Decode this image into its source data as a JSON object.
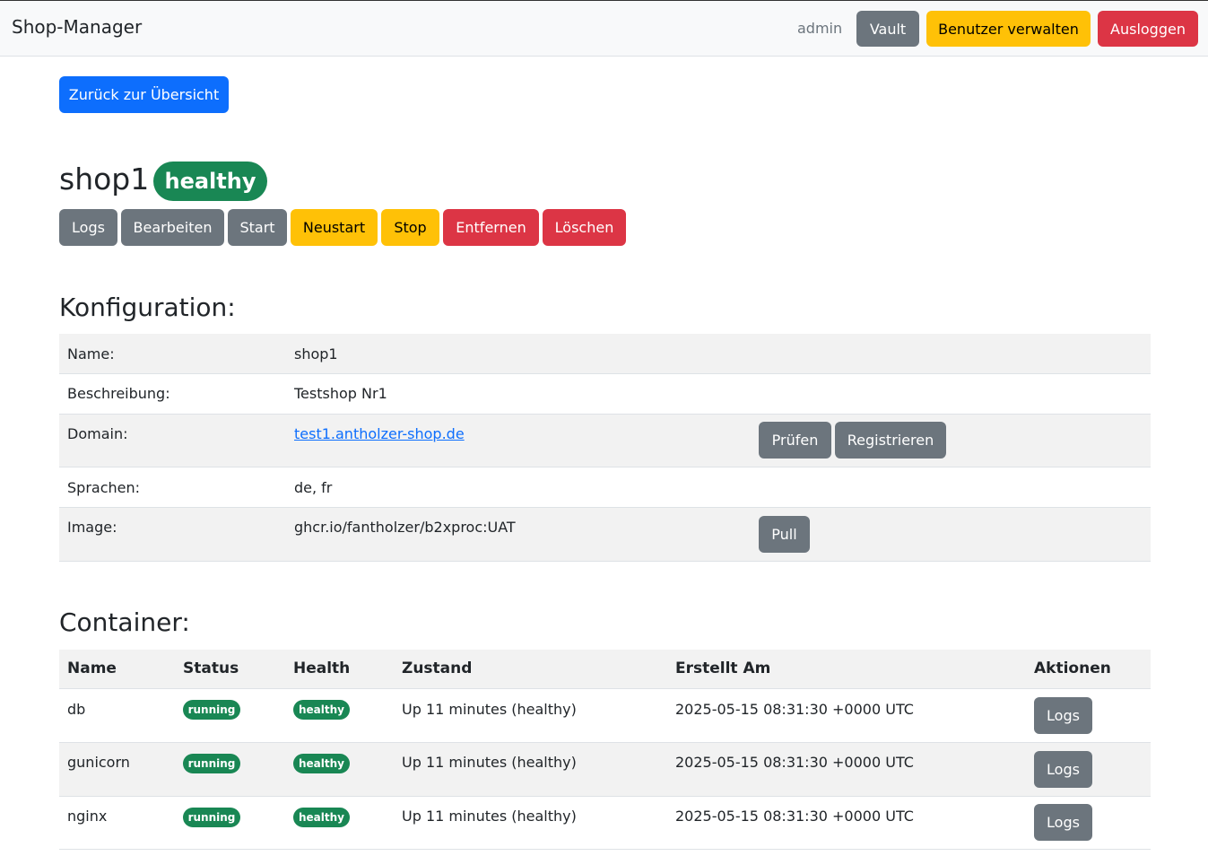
{
  "navbar": {
    "brand": "Shop-Manager",
    "user": "admin",
    "vault_label": "Vault",
    "users_label": "Benutzer verwalten",
    "logout_label": "Ausloggen"
  },
  "back_label": "Zurück zur Übersicht",
  "shop": {
    "name": "shop1",
    "status": "healthy"
  },
  "actions": {
    "logs": "Logs",
    "edit": "Bearbeiten",
    "start": "Start",
    "restart": "Neustart",
    "stop": "Stop",
    "remove": "Entfernen",
    "delete": "Löschen"
  },
  "config": {
    "heading": "Konfiguration:",
    "rows": [
      {
        "label": "Name:",
        "value": "shop1"
      },
      {
        "label": "Beschreibung:",
        "value": "Testshop Nr1"
      },
      {
        "label": "Domain:",
        "value": "test1.antholzer-shop.de",
        "check_label": "Prüfen",
        "register_label": "Registrieren"
      },
      {
        "label": "Sprachen:",
        "value": "de, fr"
      },
      {
        "label": "Image:",
        "value": "ghcr.io/fantholzer/b2xproc:UAT",
        "pull_label": "Pull"
      }
    ]
  },
  "containers": {
    "heading": "Container:",
    "columns": [
      "Name",
      "Status",
      "Health",
      "Zustand",
      "Erstellt Am",
      "Aktionen"
    ],
    "rows": [
      {
        "name": "db",
        "status": "running",
        "health": "healthy",
        "state": "Up 11 minutes (healthy)",
        "created": "2025-05-15 08:31:30 +0000 UTC",
        "action": "Logs"
      },
      {
        "name": "gunicorn",
        "status": "running",
        "health": "healthy",
        "state": "Up 11 minutes (healthy)",
        "created": "2025-05-15 08:31:30 +0000 UTC",
        "action": "Logs"
      },
      {
        "name": "nginx",
        "status": "running",
        "health": "healthy",
        "state": "Up 11 minutes (healthy)",
        "created": "2025-05-15 08:31:30 +0000 UTC",
        "action": "Logs"
      }
    ]
  },
  "colors": {
    "primary": "#0d6efd",
    "secondary": "#6c757d",
    "warning": "#ffc107",
    "danger": "#dc3545",
    "success": "#198754"
  }
}
